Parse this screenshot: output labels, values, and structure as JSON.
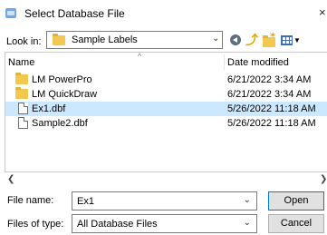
{
  "window": {
    "title": "Select Database File",
    "app_icon": "app-window-icon",
    "close_glyph": "×"
  },
  "toolbar": {
    "look_in_label": "Look in:",
    "look_in_value": "Sample Labels",
    "icons": [
      "back-icon",
      "up-folder-icon",
      "new-folder-icon",
      "view-menu-icon"
    ]
  },
  "file_list": {
    "columns": {
      "name": "Name",
      "date_modified": "Date modified"
    },
    "items": [
      {
        "name": "LM PowerPro",
        "date": "6/21/2022 3:34 AM",
        "type": "folder",
        "selected": false
      },
      {
        "name": "LM QuickDraw",
        "date": "6/21/2022 3:34 AM",
        "type": "folder",
        "selected": false
      },
      {
        "name": "Ex1.dbf",
        "date": "5/26/2022 11:18 AM",
        "type": "file",
        "selected": true
      },
      {
        "name": "Sample2.dbf",
        "date": "5/26/2022 11:18 AM",
        "type": "file",
        "selected": false
      }
    ]
  },
  "form": {
    "file_name_label": "File name:",
    "file_name_value": "Ex1",
    "file_type_label": "Files of type:",
    "file_type_value": "All Database Files"
  },
  "buttons": {
    "open": "Open",
    "cancel": "Cancel"
  },
  "colors": {
    "selection": "#cce8ff",
    "folder": "#f3c84e",
    "default_button_border": "#0078d7"
  }
}
